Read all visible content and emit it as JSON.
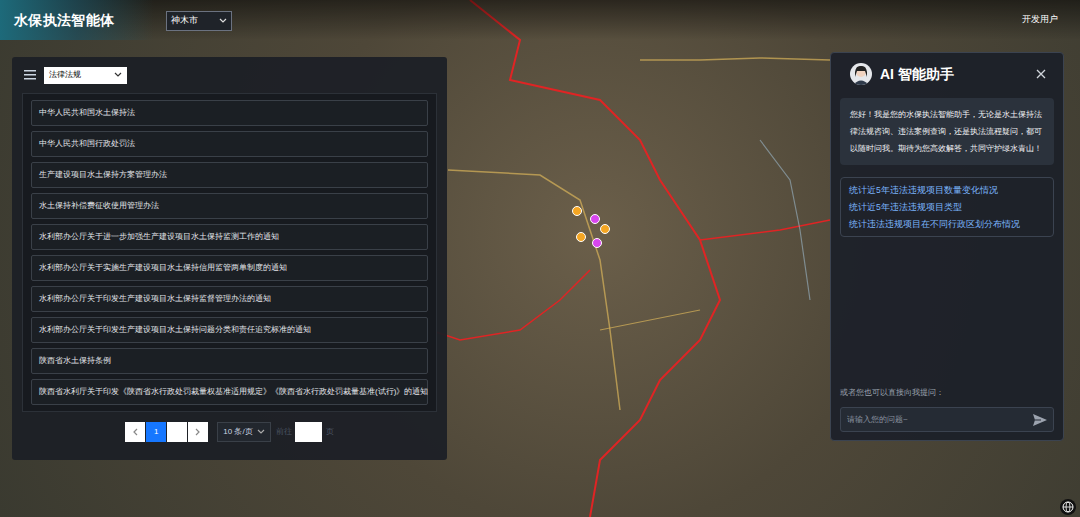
{
  "header": {
    "title": "水保执法智能体",
    "region": "神木市",
    "user": "开发用户"
  },
  "law_panel": {
    "category": "法律法规",
    "items": [
      "中华人民共和国水土保持法",
      "中华人民共和国行政处罚法",
      "生产建设项目水土保持方案管理办法",
      "水土保持补偿费征收使用管理办法",
      "水利部办公厅关于进一步加强生产建设项目水土保持监测工作的通知",
      "水利部办公厅关于实施生产建设项目水土保持信用监管两单制度的通知",
      "水利部办公厅关于印发生产建设项目水土保持监督管理办法的通知",
      "水利部办公厅关于印发生产建设项目水土保持问题分类和责任追究标准的通知",
      "陕西省水土保持条例",
      "陕西省水利厅关于印发《陕西省水行政处罚裁量权基准适用规定》《陕西省水行政处罚裁量基准(试行)》的通知"
    ],
    "pagination": {
      "pages": [
        {
          "label": "1",
          "selected": true
        },
        {
          "label": "",
          "selected": false
        }
      ],
      "page_size": "10 条/页",
      "jump_label": "前往",
      "jump_suffix": "页"
    }
  },
  "assistant": {
    "title": "AI 智能助手",
    "greeting": "您好！我是您的水保执法智能助手，无论是水土保持法律法规咨询、违法案例查询，还是执法流程疑问，都可以随时问我。期待为您高效解答，共同守护绿水青山！",
    "suggestions": [
      "统计近5年违法违规项目数量变化情况",
      "统计近5年违法违规项目类型",
      "统计违法违规项目在不同行政区划分布情况"
    ],
    "prompt": "或者您也可以直接向我提问：",
    "input": {
      "placeholder": "请输入您的问题~"
    }
  },
  "map": {
    "pins": [
      {
        "color": "#f5a623"
      },
      {
        "color": "#d946ef"
      },
      {
        "color": "#f5a623"
      },
      {
        "color": "#d946ef"
      },
      {
        "color": "#f5a623"
      }
    ]
  }
}
